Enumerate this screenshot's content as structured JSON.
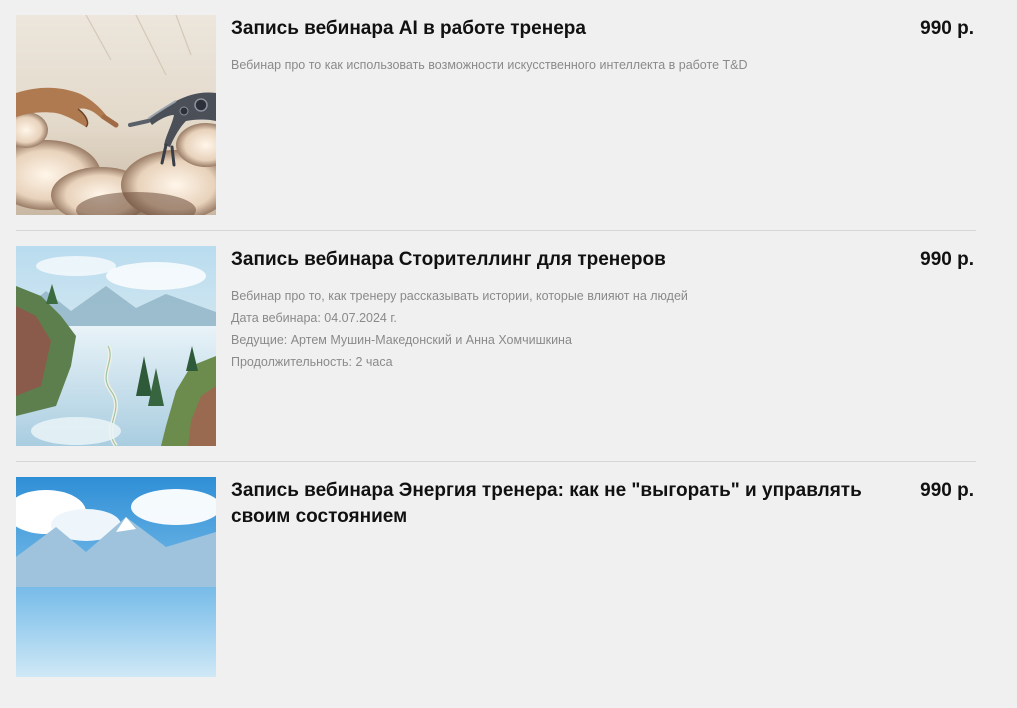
{
  "products": [
    {
      "title": "Запись вебинара AI в работе тренера",
      "price": "990 р.",
      "description": [
        "Вебинар про то как использовать возможности искусственного интеллекта в работе T&D"
      ]
    },
    {
      "title": "Запись вебинара Сторителлинг для тренеров",
      "price": "990 р.",
      "description": [
        "Вебинар про то, как тренеру рассказывать истории, которые влияют на людей",
        "Дата вебинара: 04.07.2024 г.",
        "Ведущие: Артем Мушин-Македонский и Анна Хомчишкина",
        "Продолжительность: 2 часа"
      ]
    },
    {
      "title": "Запись вебинара Энергия тренера: как не \"выгорать\" и управлять своим состоянием",
      "price": "990 р.",
      "description": []
    }
  ]
}
